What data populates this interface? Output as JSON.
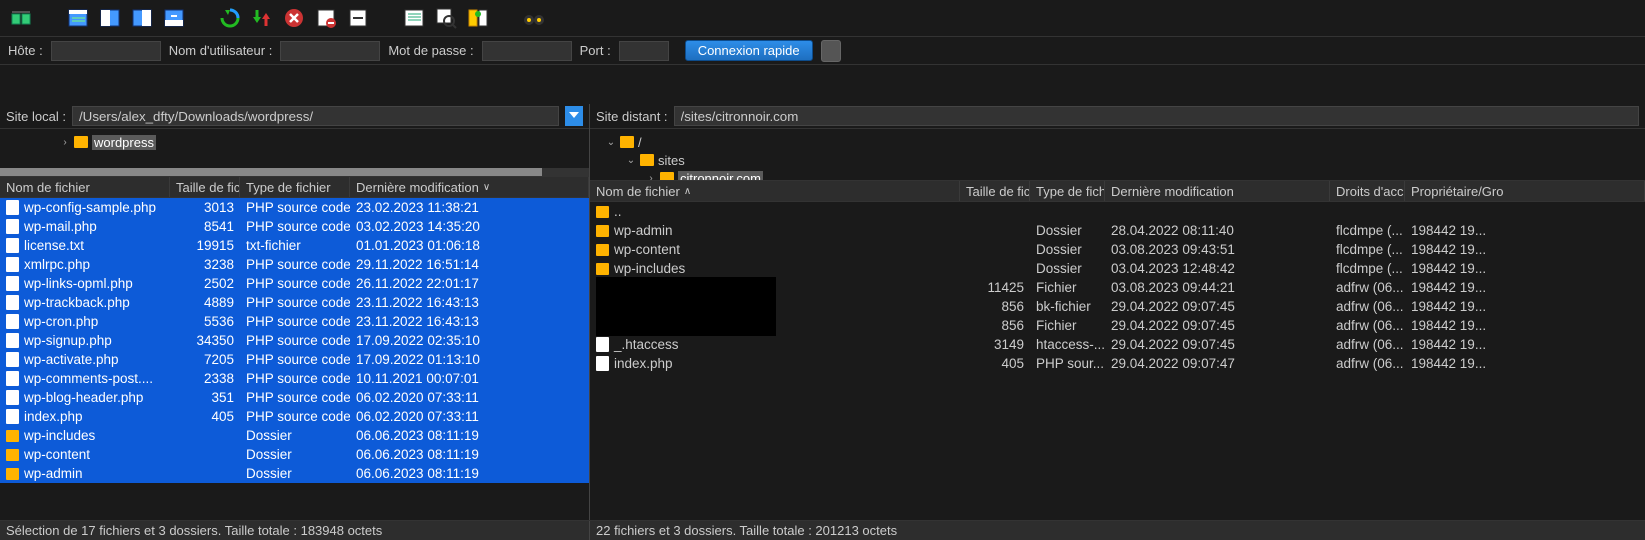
{
  "quickconnect": {
    "host_label": "Hôte :",
    "user_label": "Nom d'utilisateur :",
    "pass_label": "Mot de passe :",
    "port_label": "Port :",
    "connect_btn": "Connexion rapide"
  },
  "local": {
    "site_label": "Site local :",
    "path": "/Users/alex_dfty/Downloads/wordpress/",
    "tree_item": "wordpress",
    "headers": {
      "name": "Nom de fichier",
      "size": "Taille de fichie",
      "type": "Type de fichier",
      "date": "Dernière modification"
    },
    "rows": [
      {
        "icon": "file",
        "name": "wp-config-sample.php",
        "size": "3013",
        "type": "PHP source code",
        "date": "23.02.2023 11:38:21"
      },
      {
        "icon": "file",
        "name": "wp-mail.php",
        "size": "8541",
        "type": "PHP source code",
        "date": "03.02.2023 14:35:20"
      },
      {
        "icon": "file",
        "name": "license.txt",
        "size": "19915",
        "type": "txt-fichier",
        "date": "01.01.2023 01:06:18"
      },
      {
        "icon": "file",
        "name": "xmlrpc.php",
        "size": "3238",
        "type": "PHP source code",
        "date": "29.11.2022 16:51:14"
      },
      {
        "icon": "file",
        "name": "wp-links-opml.php",
        "size": "2502",
        "type": "PHP source code",
        "date": "26.11.2022 22:01:17"
      },
      {
        "icon": "file",
        "name": "wp-trackback.php",
        "size": "4889",
        "type": "PHP source code",
        "date": "23.11.2022 16:43:13"
      },
      {
        "icon": "file",
        "name": "wp-cron.php",
        "size": "5536",
        "type": "PHP source code",
        "date": "23.11.2022 16:43:13"
      },
      {
        "icon": "file",
        "name": "wp-signup.php",
        "size": "34350",
        "type": "PHP source code",
        "date": "17.09.2022 02:35:10"
      },
      {
        "icon": "file",
        "name": "wp-activate.php",
        "size": "7205",
        "type": "PHP source code",
        "date": "17.09.2022 01:13:10"
      },
      {
        "icon": "file",
        "name": "wp-comments-post....",
        "size": "2338",
        "type": "PHP source code",
        "date": "10.11.2021 00:07:01"
      },
      {
        "icon": "file",
        "name": "wp-blog-header.php",
        "size": "351",
        "type": "PHP source code",
        "date": "06.02.2020 07:33:11"
      },
      {
        "icon": "file",
        "name": "index.php",
        "size": "405",
        "type": "PHP source code",
        "date": "06.02.2020 07:33:11"
      },
      {
        "icon": "fldr",
        "name": "wp-includes",
        "size": "",
        "type": "Dossier",
        "date": "06.06.2023 08:11:19"
      },
      {
        "icon": "fldr",
        "name": "wp-content",
        "size": "",
        "type": "Dossier",
        "date": "06.06.2023 08:11:19"
      },
      {
        "icon": "fldr",
        "name": "wp-admin",
        "size": "",
        "type": "Dossier",
        "date": "06.06.2023 08:11:19"
      }
    ],
    "status": "Sélection de 17 fichiers et 3 dossiers. Taille totale : 183948 octets"
  },
  "remote": {
    "site_label": "Site distant :",
    "path": "/sites/citronnoir.com",
    "tree_root": "/",
    "tree_sites": "sites",
    "tree_sel": "citronnoir.com",
    "headers": {
      "name": "Nom de fichier",
      "size": "Taille de fichi",
      "type": "Type de fichier",
      "date": "Dernière modification",
      "perm": "Droits d'accès",
      "owner": "Propriétaire/Gro"
    },
    "parent": "..",
    "rows_top": [
      {
        "icon": "fldr",
        "name": "wp-admin",
        "size": "",
        "type": "Dossier",
        "date": "28.04.2022 08:11:40",
        "perm": "flcdmpe (...",
        "owner": "198442 19..."
      },
      {
        "icon": "fldr",
        "name": "wp-content",
        "size": "",
        "type": "Dossier",
        "date": "03.08.2023 09:43:51",
        "perm": "flcdmpe (...",
        "owner": "198442 19..."
      },
      {
        "icon": "fldr",
        "name": "wp-includes",
        "size": "",
        "type": "Dossier",
        "date": "03.04.2023 12:48:42",
        "perm": "flcdmpe (...",
        "owner": "198442 19..."
      }
    ],
    "rows_mid": [
      {
        "size": "11425",
        "type": "Fichier",
        "date": "03.08.2023 09:44:21",
        "perm": "adfrw (06...",
        "owner": "198442 19..."
      },
      {
        "size": "856",
        "type": "bk-fichier",
        "date": "29.04.2022 09:07:45",
        "perm": "adfrw (06...",
        "owner": "198442 19..."
      },
      {
        "size": "856",
        "type": "Fichier",
        "date": "29.04.2022 09:07:45",
        "perm": "adfrw (06...",
        "owner": "198442 19..."
      }
    ],
    "rows_bot": [
      {
        "icon": "file",
        "name": "_.htaccess",
        "size": "3149",
        "type": "htaccess-...",
        "date": "29.04.2022 09:07:45",
        "perm": "adfrw (06...",
        "owner": "198442 19..."
      },
      {
        "icon": "file",
        "name": "index.php",
        "size": "405",
        "type": "PHP sour...",
        "date": "29.04.2022 09:07:47",
        "perm": "adfrw (06...",
        "owner": "198442 19..."
      }
    ],
    "status": "22 fichiers et 3 dossiers. Taille totale : 201213 octets"
  }
}
